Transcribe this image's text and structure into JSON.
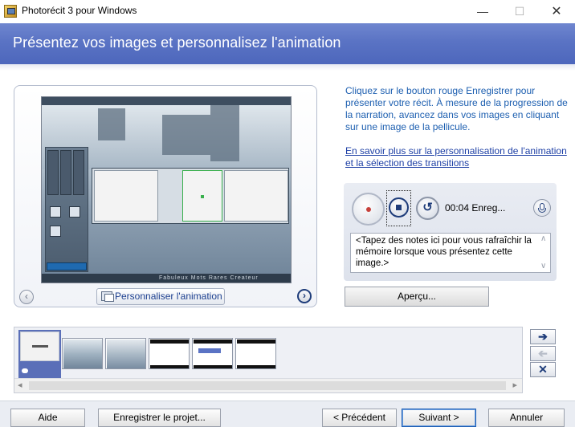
{
  "window": {
    "title": "Photorécit 3 pour Windows",
    "controls": {
      "minimize": "—",
      "maximize": "☐",
      "close": "✕"
    }
  },
  "header": {
    "title": "Présentez vos images et personnalisez l'animation"
  },
  "preview": {
    "customize_label": "Personnaliser l'animation",
    "prev_icon": "chevron-left-icon",
    "next_icon": "chevron-right-icon",
    "inner_credits": "Fabuleux Mots Rares Createur"
  },
  "instructions": {
    "text": "Cliquez sur le bouton rouge Enregistrer pour présenter votre récit. À mesure de la progression de la narration, avancez dans vos images en cliquant sur une image de la pellicule.",
    "link": "En savoir plus sur la personnalisation de l'animation et la sélection des transitions"
  },
  "recorder": {
    "timer": "00:04  Enreg...",
    "undo_glyph": "↺",
    "notes": "<Tapez des notes ici pour vous rafraîchir la mémoire lorsque vous présentez cette image.>",
    "colors": {
      "record": "#c7403a",
      "accent": "#1e3c7a"
    }
  },
  "apercu": {
    "label": "Aperçu..."
  },
  "filmstrip": {
    "side_buttons": {
      "right": "➔",
      "left": "➔",
      "delete": "✕"
    },
    "scroll": {
      "left": "◂",
      "right": "▸"
    }
  },
  "footer": {
    "help": "Aide",
    "save_project": "Enregistrer le projet...",
    "previous": "< Précédent",
    "next": "Suivant >",
    "cancel": "Annuler"
  }
}
